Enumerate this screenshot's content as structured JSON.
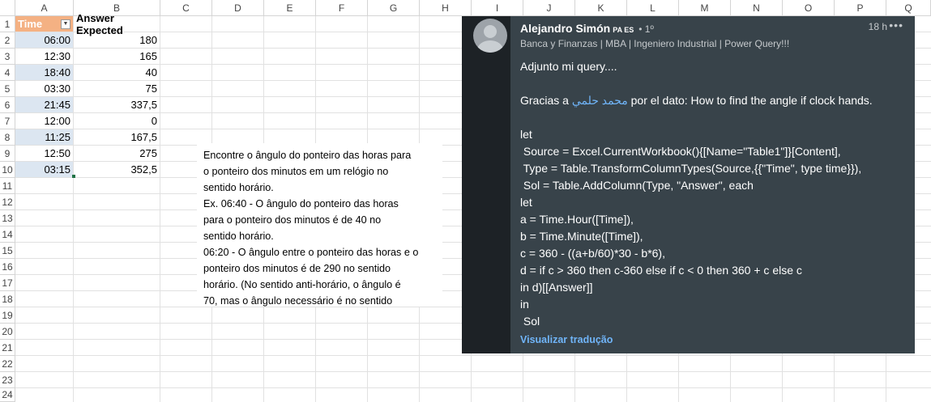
{
  "spreadsheet": {
    "columns": [
      "A",
      "B",
      "C",
      "D",
      "E",
      "F",
      "G",
      "H",
      "I",
      "J",
      "K",
      "L",
      "M",
      "N",
      "O",
      "P",
      "Q"
    ],
    "rows": [
      "1",
      "2",
      "3",
      "4",
      "5",
      "6",
      "7",
      "8",
      "9",
      "10",
      "11",
      "12",
      "13",
      "14",
      "15",
      "16",
      "17",
      "18",
      "19",
      "20",
      "21",
      "22",
      "23",
      "24"
    ],
    "header_a": "Time",
    "header_b": "Answer Expected",
    "data": [
      {
        "time": "06:00",
        "answer": "180"
      },
      {
        "time": "12:30",
        "answer": "165"
      },
      {
        "time": "18:40",
        "answer": "40"
      },
      {
        "time": "03:30",
        "answer": "75"
      },
      {
        "time": "21:45",
        "answer": "337,5"
      },
      {
        "time": "12:00",
        "answer": "0"
      },
      {
        "time": "11:25",
        "answer": "167,5"
      },
      {
        "time": "12:50",
        "answer": "275"
      },
      {
        "time": "03:15",
        "answer": "352,5"
      }
    ],
    "header_colors": {
      "time_header": "#f4b183",
      "time_cells": "#dce6f1"
    }
  },
  "textbox": {
    "lines": [
      "Encontre o ângulo do ponteiro das horas para",
      "o ponteiro dos minutos em um relógio no",
      "sentido horário.",
      "Ex. 06:40 - O ângulo do ponteiro das horas",
      "para o ponteiro dos minutos é de 40 no",
      "sentido horário.",
      "06:20 - O ângulo entre o ponteiro das horas e o",
      "ponteiro dos minutos é de 290 no sentido",
      "horário. (No sentido anti-horário, o ângulo é",
      "70, mas o ângulo necessário é no sentido"
    ]
  },
  "post": {
    "author": "Alejandro Simón",
    "author_tag": "PA ES",
    "degree": "• 1º",
    "time": "18 h",
    "more": "•••",
    "headline": "Banca y Finanzas | MBA | Ingeniero Industrial | Power Query!!!",
    "greeting": "Adjunto mi query....",
    "thanks_prefix": "Gracias a ",
    "mention": "محمد حلمي",
    "thanks_suffix": " por el dato: How to find the angle if clock hands.",
    "code_lines": [
      "let",
      " Source = Excel.CurrentWorkbook(){[Name=\"Table1\"]}[Content],",
      " Type = Table.TransformColumnTypes(Source,{{\"Time\", type time}}),",
      " Sol = Table.AddColumn(Type, \"Answer\", each",
      "let",
      "a = Time.Hour([Time]),",
      "b = Time.Minute([Time]),",
      "c = 360 - ((a+b/60)*30 - b*6),",
      "d = if c > 360 then c-360 else if c < 0 then 360 + c else c",
      "in d)[[Answer]]",
      "in",
      " Sol"
    ],
    "translate": "Visualizar tradução",
    "colors": {
      "bg": "#38434a",
      "accent": "#70b5f9"
    }
  }
}
